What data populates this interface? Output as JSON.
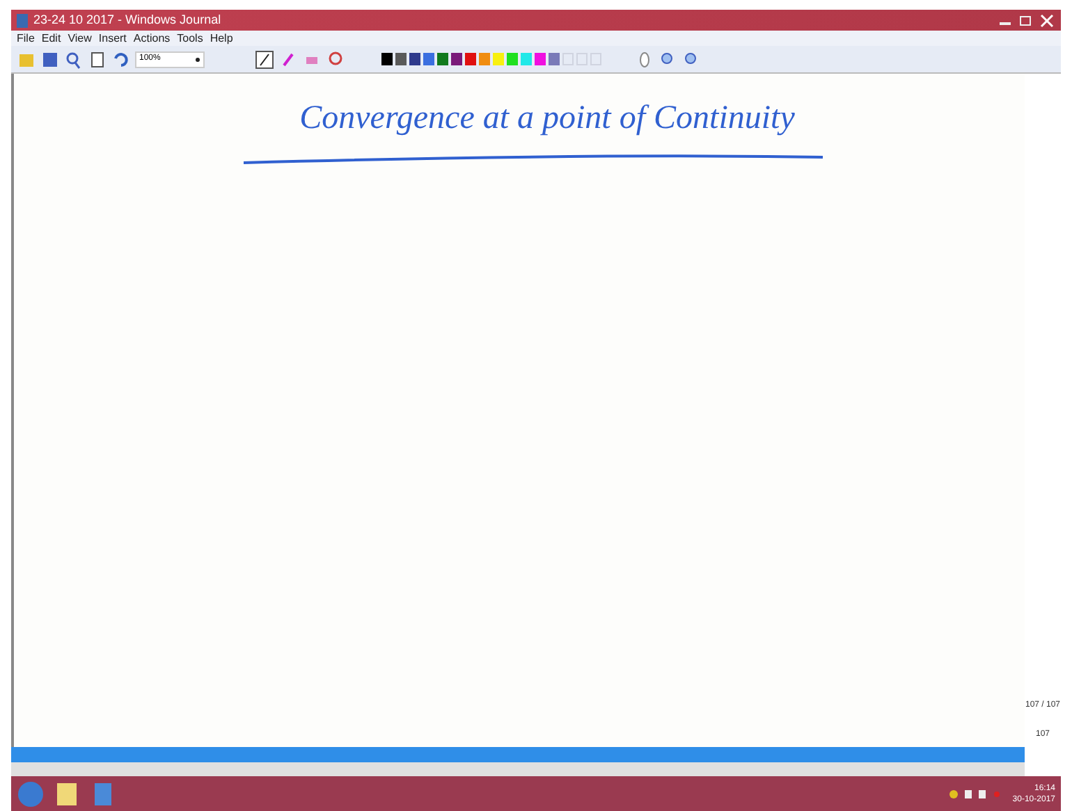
{
  "window": {
    "title": "23-24 10 2017 - Windows Journal"
  },
  "menu": [
    "File",
    "Edit",
    "View",
    "Insert",
    "Actions",
    "Tools",
    "Help"
  ],
  "toolbar": {
    "zoom": "100%"
  },
  "pen_colors": [
    {
      "color": "#000000"
    },
    {
      "color": "#5a5a5a"
    },
    {
      "color": "#2e3a8c"
    },
    {
      "color": "#3b6fe0"
    },
    {
      "color": "#117a1e"
    },
    {
      "color": "#7a1a7a"
    },
    {
      "color": "#e01010"
    },
    {
      "color": "#f08c10"
    },
    {
      "color": "#f8f010"
    },
    {
      "color": "#20e020"
    },
    {
      "color": "#20e8e8"
    },
    {
      "color": "#f010e0"
    },
    {
      "color": "#7a7ab8"
    }
  ],
  "note": {
    "heading": "Convergence at a point of Continuity"
  },
  "page_panel": {
    "page_count": "107 / 107",
    "current_page": "107"
  },
  "clock": {
    "time": "16:14",
    "date": "30-10-2017"
  }
}
